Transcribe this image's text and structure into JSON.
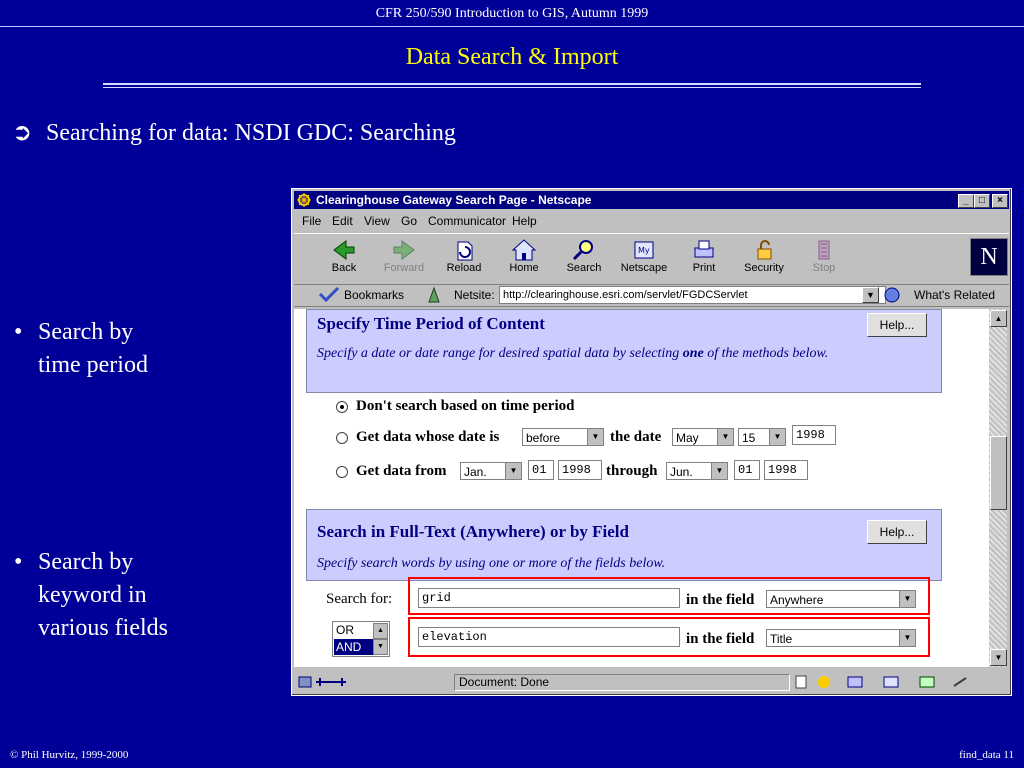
{
  "slide": {
    "course": "CFR 250/590 Introduction to GIS, Autumn 1999",
    "title": "Data Search  & Import",
    "main_bullet_glyph": "➲",
    "main_bullet": "Searching for data: NSDI GDC: Searching",
    "sub_bullets": [
      {
        "dot": "•",
        "lines": [
          "Search by",
          "time period"
        ]
      },
      {
        "dot": "•",
        "lines": [
          "Search by",
          "keyword in",
          "various fields"
        ]
      }
    ],
    "footer_left": "© Phil Hurvitz, 1999-2000",
    "footer_right": "find_data 11"
  },
  "browser": {
    "window_title": "Clearinghouse Gateway Search Page - Netscape",
    "window_buttons": [
      "_",
      "□",
      "×"
    ],
    "menu": [
      "File",
      "Edit",
      "View",
      "Go",
      "Communicator",
      "Help"
    ],
    "toolbar": [
      {
        "label": "Back",
        "icon": "back-arrow-icon",
        "disabled": false
      },
      {
        "label": "Forward",
        "icon": "forward-arrow-icon",
        "disabled": true
      },
      {
        "label": "Reload",
        "icon": "reload-icon",
        "disabled": false
      },
      {
        "label": "Home",
        "icon": "home-icon",
        "disabled": false
      },
      {
        "label": "Search",
        "icon": "search-icon",
        "disabled": false
      },
      {
        "label": "Netscape",
        "icon": "netscape-icon",
        "disabled": false
      },
      {
        "label": "Print",
        "icon": "print-icon",
        "disabled": false
      },
      {
        "label": "Security",
        "icon": "security-lock-icon",
        "disabled": false
      },
      {
        "label": "Stop",
        "icon": "stop-icon",
        "disabled": true
      }
    ],
    "logo_letter": "N",
    "bookmarks_label": "Bookmarks",
    "netsite_label": "Netsite:",
    "url": "http://clearinghouse.esri.com/servlet/FGDCServlet",
    "whats_related": "What's Related",
    "status": "Document: Done"
  },
  "page": {
    "time_panel": {
      "heading": "Specify Time Period of Content",
      "help": "Help...",
      "desc_before": "Specify a date or date range for desired spatial data by selecting ",
      "desc_bold": "one",
      "desc_after": " of the methods below."
    },
    "time_options": {
      "none_label": "Don't search based on time period",
      "date_is_label": "Get data whose date is",
      "date_is_mode": "before",
      "the_date_label": "the date",
      "date_month": "May",
      "date_day": "15",
      "date_year": "1998",
      "from_label": "Get data from",
      "from_month": "Jan.",
      "from_day": "01",
      "from_year": "1998",
      "through_label": "through",
      "to_month": "Jun.",
      "to_day": "01",
      "to_year": "1998"
    },
    "text_panel": {
      "heading": "Search in Full-Text (Anywhere) or by Field",
      "help": "Help...",
      "desc": "Specify search words by using one or more of the fields below."
    },
    "search": {
      "search_for_label": "Search for:",
      "term1": "grid",
      "in_field_label": "in the field",
      "field1": "Anywhere",
      "operators": [
        "OR",
        "AND"
      ],
      "term2": "elevation",
      "field2": "Title"
    }
  },
  "colors": {
    "slide_bg": "#000099",
    "title_yellow": "#ffff00",
    "panel_bg": "#ccccff",
    "highlight_red": "#ff0000"
  }
}
